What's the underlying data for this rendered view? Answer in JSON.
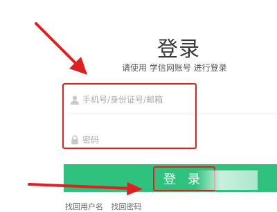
{
  "login": {
    "title": "登录",
    "subtitle": "请使用 学信网账号 进行登录",
    "username_placeholder": "手机号/身份证号/邮箱",
    "password_placeholder": "密码",
    "button_label": "登 录",
    "footer": {
      "link1": "找回用户名",
      "link2": "找回密码"
    }
  },
  "icons": {
    "user": "user-icon",
    "lock": "lock-icon"
  },
  "colors": {
    "primary_button": "#2ec27e",
    "annotation_red": "#e02020",
    "text": "#3a3a3a",
    "placeholder": "#a9a9a9"
  }
}
